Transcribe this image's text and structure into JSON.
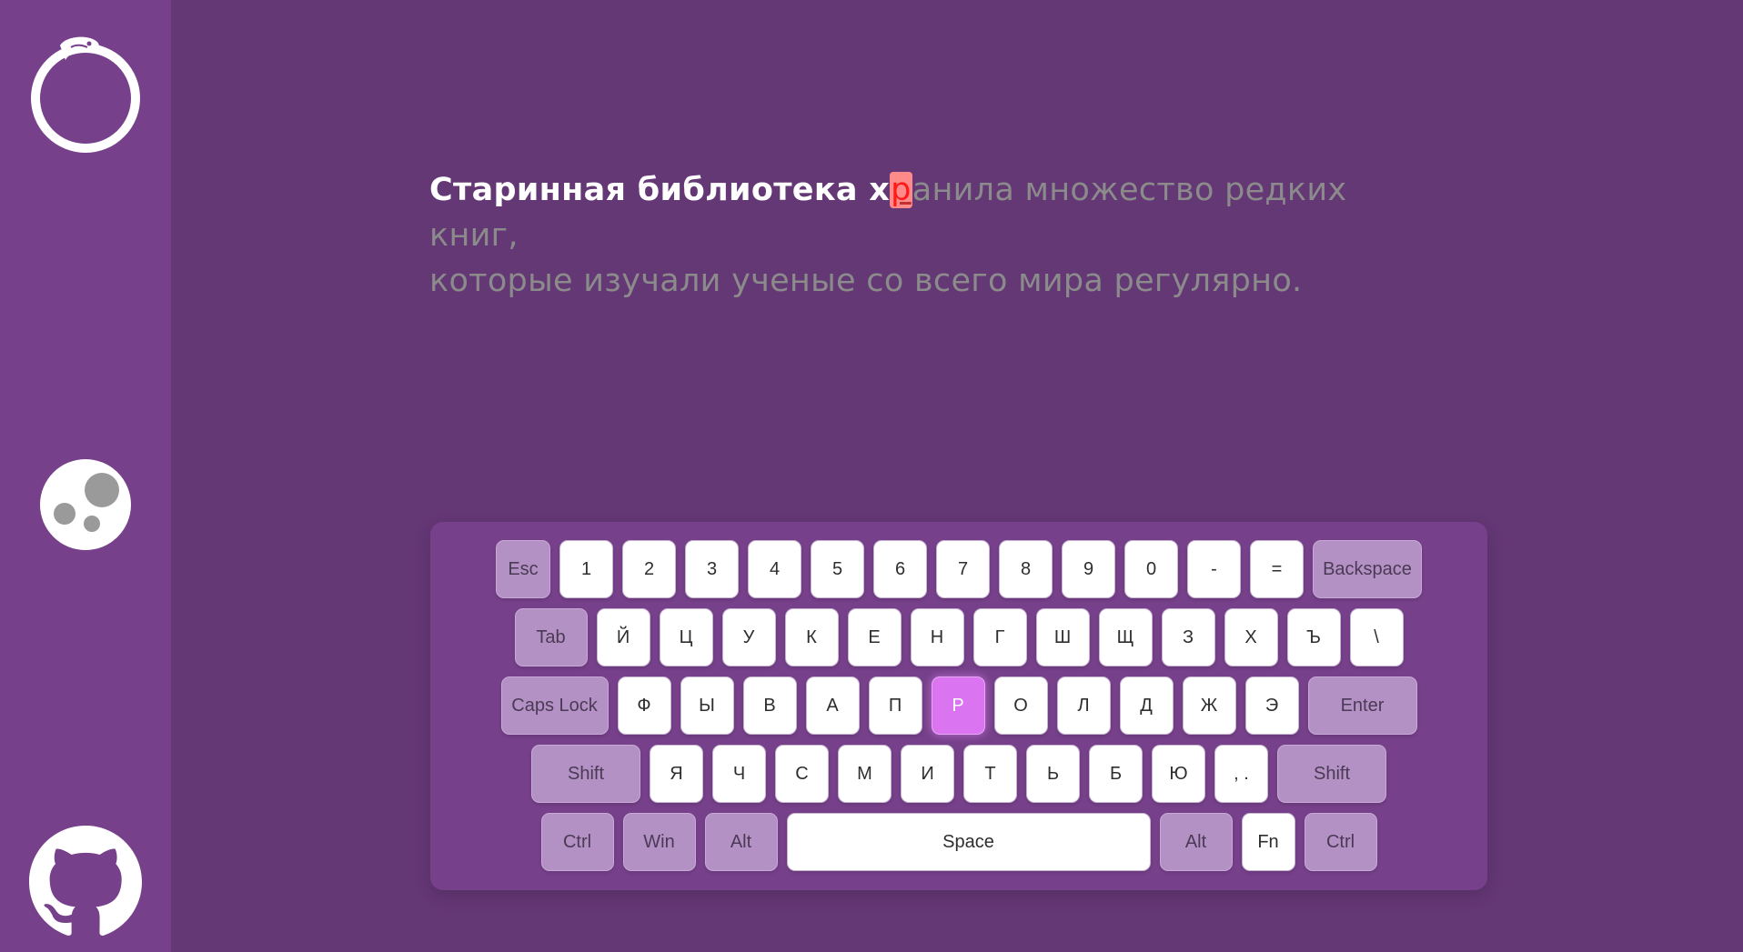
{
  "sidebar": {
    "items": [
      {
        "name": "ouroboros-logo-icon"
      },
      {
        "name": "theme-palette-icon"
      },
      {
        "name": "github-icon"
      }
    ]
  },
  "prompt": {
    "typed": "Старинная библиотека х",
    "current": "р",
    "pending": "анила множество редких книг,\nкоторые изучали ученые со всего мира регулярно."
  },
  "keyboard": {
    "rows": [
      [
        {
          "label": "Esc",
          "mod": true,
          "w": "esc"
        },
        {
          "label": "1"
        },
        {
          "label": "2"
        },
        {
          "label": "3"
        },
        {
          "label": "4"
        },
        {
          "label": "5"
        },
        {
          "label": "6"
        },
        {
          "label": "7"
        },
        {
          "label": "8"
        },
        {
          "label": "9"
        },
        {
          "label": "0"
        },
        {
          "label": "-"
        },
        {
          "label": "="
        },
        {
          "label": "Backspace",
          "mod": true,
          "w": "backspace"
        }
      ],
      [
        {
          "label": "Tab",
          "mod": true,
          "w": "tab"
        },
        {
          "label": "Й"
        },
        {
          "label": "Ц"
        },
        {
          "label": "У"
        },
        {
          "label": "К"
        },
        {
          "label": "Е"
        },
        {
          "label": "Н"
        },
        {
          "label": "Г"
        },
        {
          "label": "Ш"
        },
        {
          "label": "Щ"
        },
        {
          "label": "З"
        },
        {
          "label": "Х"
        },
        {
          "label": "Ъ"
        },
        {
          "label": "\\"
        }
      ],
      [
        {
          "label": "Caps Lock",
          "mod": true,
          "w": "caps"
        },
        {
          "label": "Ф"
        },
        {
          "label": "Ы"
        },
        {
          "label": "В"
        },
        {
          "label": "А"
        },
        {
          "label": "П"
        },
        {
          "label": "Р",
          "active": true
        },
        {
          "label": "О"
        },
        {
          "label": "Л"
        },
        {
          "label": "Д"
        },
        {
          "label": "Ж"
        },
        {
          "label": "Э"
        },
        {
          "label": "Enter",
          "mod": true,
          "w": "enter"
        }
      ],
      [
        {
          "label": "Shift",
          "mod": true,
          "w": "shift"
        },
        {
          "label": "Я"
        },
        {
          "label": "Ч"
        },
        {
          "label": "С"
        },
        {
          "label": "М"
        },
        {
          "label": "И"
        },
        {
          "label": "Т"
        },
        {
          "label": "Ь"
        },
        {
          "label": "Б"
        },
        {
          "label": "Ю"
        },
        {
          "label": ", ."
        },
        {
          "label": "Shift",
          "mod": true,
          "w": "shift"
        }
      ],
      [
        {
          "label": "Ctrl",
          "mod": true,
          "w": "ctrl"
        },
        {
          "label": "Win",
          "mod": true,
          "w": "win"
        },
        {
          "label": "Alt",
          "mod": true,
          "w": "alt"
        },
        {
          "label": "Space",
          "w": "space"
        },
        {
          "label": "Alt",
          "mod": true,
          "w": "alt"
        },
        {
          "label": "Fn"
        },
        {
          "label": "Ctrl",
          "mod": true,
          "w": "ctrl"
        }
      ]
    ]
  },
  "colors": {
    "background": "#643775",
    "sidebar": "#76408a",
    "active_key": "#da74f0",
    "error_highlight": "#ff8a8a",
    "pending_text": "#8b8b8b"
  }
}
